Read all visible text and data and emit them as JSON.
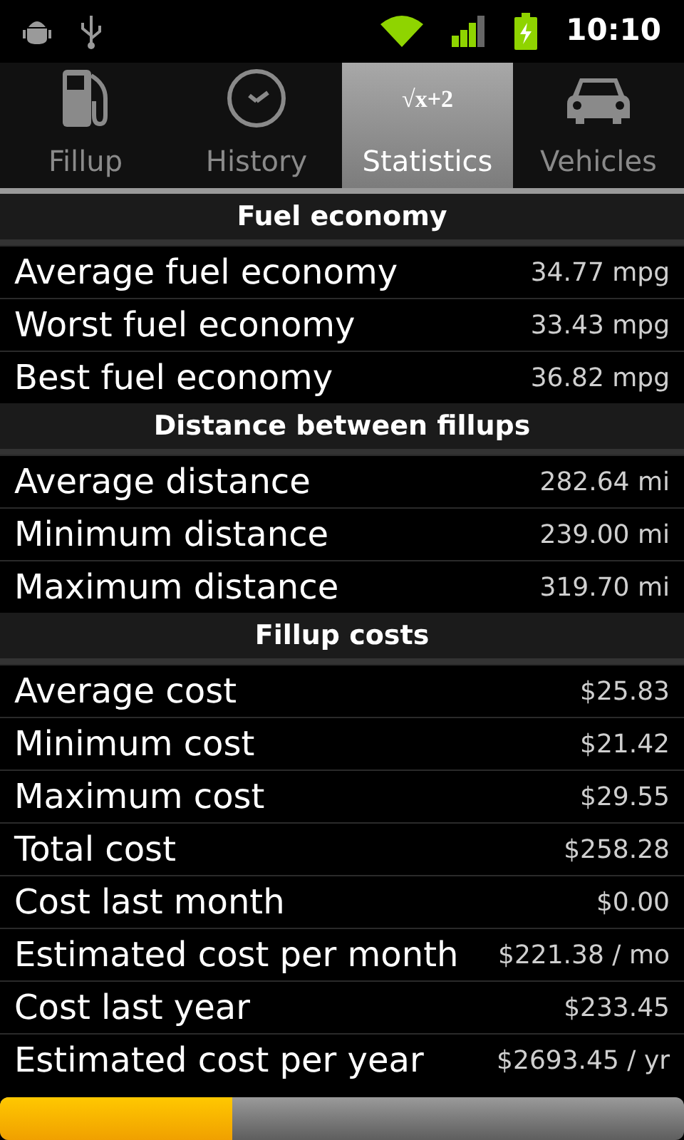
{
  "status_bar": {
    "time": "10:10"
  },
  "tabs": [
    {
      "label": "Fillup",
      "kind": "pump",
      "selected": false
    },
    {
      "label": "History",
      "kind": "clock",
      "selected": false
    },
    {
      "label": "Statistics",
      "kind": "formula",
      "formula": "√x+2",
      "selected": true
    },
    {
      "label": "Vehicles",
      "kind": "car",
      "selected": false
    }
  ],
  "sections": [
    {
      "title": "Fuel economy",
      "rows": [
        {
          "label": "Average fuel economy",
          "value": "34.77 mpg"
        },
        {
          "label": "Worst fuel economy",
          "value": "33.43 mpg"
        },
        {
          "label": "Best fuel economy",
          "value": "36.82 mpg"
        }
      ]
    },
    {
      "title": "Distance between fillups",
      "rows": [
        {
          "label": "Average distance",
          "value": "282.64 mi"
        },
        {
          "label": "Minimum distance",
          "value": "239.00 mi"
        },
        {
          "label": "Maximum distance",
          "value": "319.70 mi"
        }
      ]
    },
    {
      "title": "Fillup costs",
      "rows": [
        {
          "label": "Average cost",
          "value": "$25.83"
        },
        {
          "label": "Minimum cost",
          "value": "$21.42"
        },
        {
          "label": "Maximum cost",
          "value": "$29.55"
        },
        {
          "label": "Total cost",
          "value": "$258.28"
        },
        {
          "label": "Cost last month",
          "value": "$0.00"
        },
        {
          "label": "Estimated cost per month",
          "value": "$221.38 / mo"
        },
        {
          "label": "Cost last year",
          "value": "$233.45"
        },
        {
          "label": "Estimated cost per year",
          "value": "$2693.45 / yr"
        }
      ]
    }
  ],
  "scroll_progress": {
    "level": 0.34
  }
}
